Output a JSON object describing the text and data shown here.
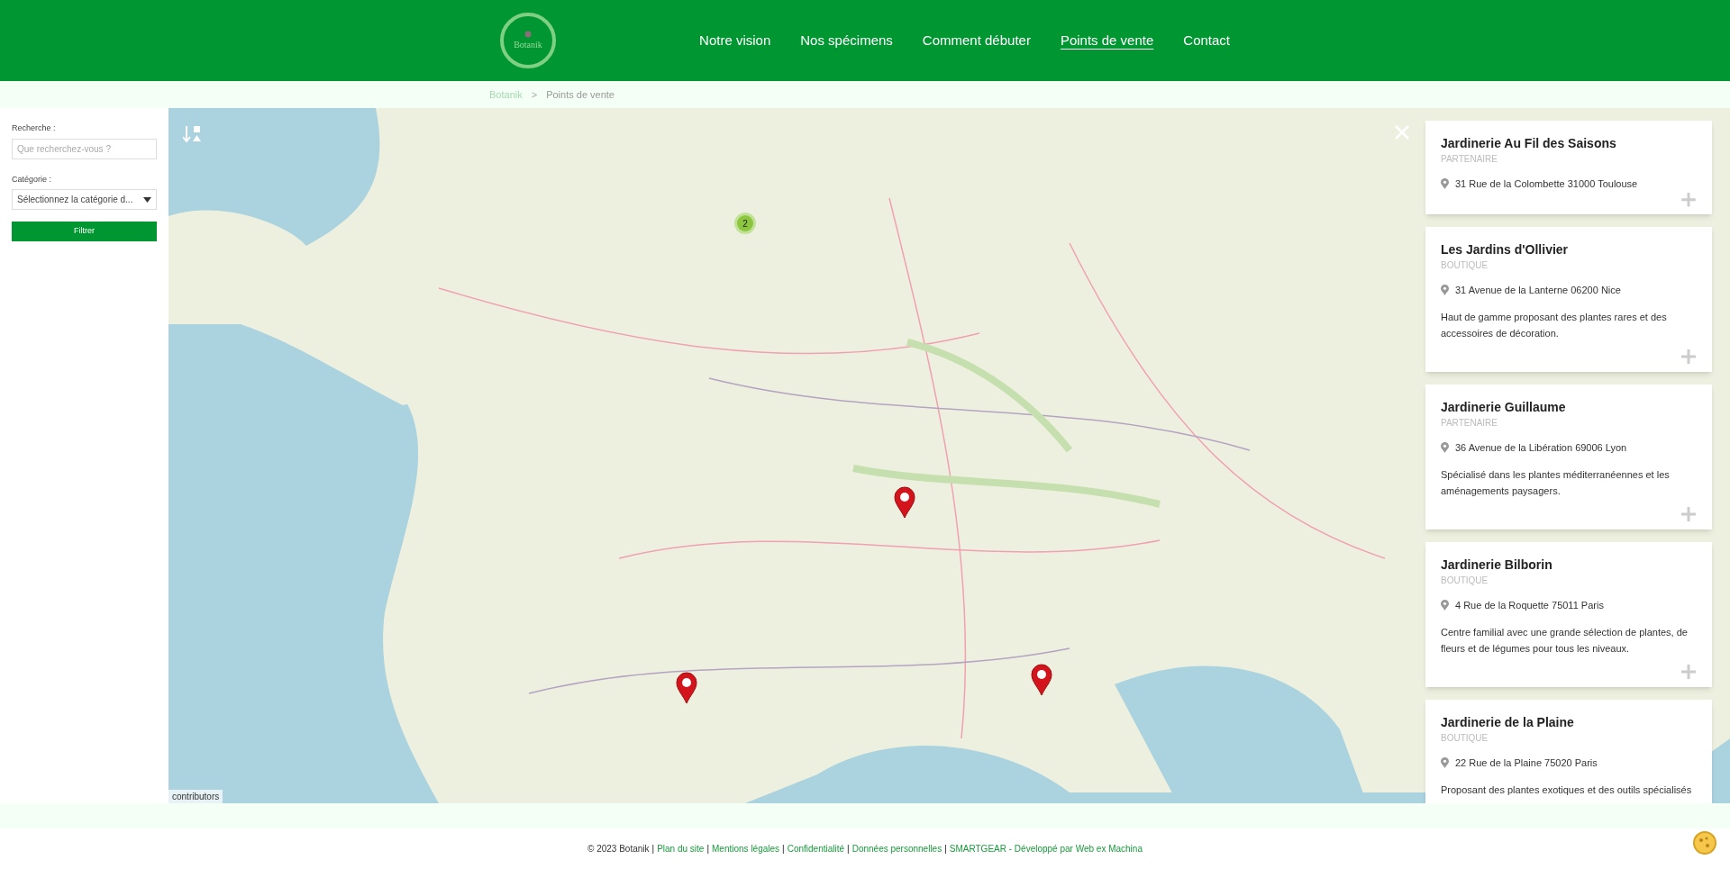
{
  "header": {
    "logo_text": "Botanik",
    "nav": [
      {
        "label": "Notre vision",
        "selected": false
      },
      {
        "label": "Nos spécimens",
        "selected": false
      },
      {
        "label": "Comment débuter",
        "selected": false
      },
      {
        "label": "Points de vente",
        "selected": true
      },
      {
        "label": "Contact",
        "selected": false
      }
    ]
  },
  "breadcrumb": {
    "home": "Botanik",
    "separator": ">",
    "current": "Points de vente"
  },
  "filters": {
    "search_label": "Recherche :",
    "search_placeholder": "Que recherchez-vous ?",
    "category_label": "Catégorie :",
    "category_value": "Sélectionnez la catégorie d...",
    "button": "Filtrer"
  },
  "map": {
    "cluster_count": "2",
    "attribution": "contributors"
  },
  "stores": [
    {
      "name": "Jardinerie Au Fil des Saisons",
      "type": "PARTENAIRE",
      "address": "31 Rue de la Colombette 31000 Toulouse"
    },
    {
      "name": "Les Jardins d'Ollivier",
      "type": "BOUTIQUE",
      "address": "31 Avenue de la Lanterne 06200 Nice",
      "description": "Haut de gamme proposant des plantes rares et des accessoires de décoration."
    },
    {
      "name": "Jardinerie Guillaume",
      "type": "PARTENAIRE",
      "address": "36 Avenue de la Libération 69006 Lyon",
      "description": "Spécialisé dans les plantes méditerranéennes et les aménagements paysagers."
    },
    {
      "name": "Jardinerie Bilborin",
      "type": "BOUTIQUE",
      "address": "4 Rue de la Roquette 75011 Paris",
      "description": "Centre familial avec une grande sélection de plantes, de fleurs et de légumes pour tous les niveaux."
    },
    {
      "name": "Jardinerie de la Plaine",
      "type": "BOUTIQUE",
      "address": "22 Rue de la Plaine 75020 Paris",
      "description": "Proposant des plantes exotiques et des outils spécialisés"
    }
  ],
  "footer": [
    {
      "kind": "text",
      "text": "© 2023 Botanik"
    },
    {
      "kind": "separator",
      "text": "|"
    },
    {
      "kind": "link",
      "text": "Plan du site"
    },
    {
      "kind": "separator",
      "text": "|"
    },
    {
      "kind": "link",
      "text": "Mentions légales"
    },
    {
      "kind": "separator",
      "text": "|"
    },
    {
      "kind": "link",
      "text": "Confidentialité"
    },
    {
      "kind": "separator",
      "text": "|"
    },
    {
      "kind": "link",
      "text": "Données personnelles"
    },
    {
      "kind": "separator",
      "text": "|"
    },
    {
      "kind": "link",
      "text": "SMARTGEAR - Développé par Web ex Machina"
    }
  ]
}
